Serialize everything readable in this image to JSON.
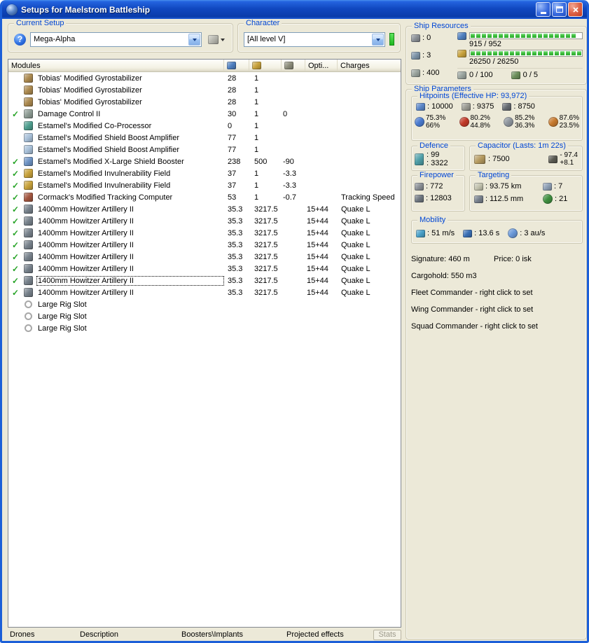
{
  "window": {
    "title": "Setups for Maelstrom Battleship"
  },
  "setup_panel": {
    "label": "Current Setup",
    "value": "Mega-Alpha"
  },
  "character_panel": {
    "label": "Character",
    "value": "[All level V]"
  },
  "modules_table": {
    "title": "Modules",
    "opti_column": "Opti...",
    "charges_column": "Charges",
    "rows": [
      {
        "active": false,
        "selected": false,
        "icon": "gyrostabilizer-icon",
        "shape": "square",
        "color": "#AC8A50",
        "name": "Tobias' Modified Gyrostabilizer",
        "cpu": "28",
        "pg": "1",
        "cap": "",
        "opti": "",
        "charges": ""
      },
      {
        "active": false,
        "selected": false,
        "icon": "gyrostabilizer-icon",
        "shape": "square",
        "color": "#AC8A50",
        "name": "Tobias' Modified Gyrostabilizer",
        "cpu": "28",
        "pg": "1",
        "cap": "",
        "opti": "",
        "charges": ""
      },
      {
        "active": false,
        "selected": false,
        "icon": "gyrostabilizer-icon",
        "shape": "square",
        "color": "#AC8A50",
        "name": "Tobias' Modified Gyrostabilizer",
        "cpu": "28",
        "pg": "1",
        "cap": "",
        "opti": "",
        "charges": ""
      },
      {
        "active": true,
        "selected": false,
        "icon": "damage-control-icon",
        "shape": "square",
        "color": "#8E9C94",
        "name": "Damage Control II",
        "cpu": "30",
        "pg": "1",
        "cap": "0",
        "opti": "",
        "charges": ""
      },
      {
        "active": false,
        "selected": false,
        "icon": "co-processor-icon",
        "shape": "square",
        "color": "#4E9E8E",
        "name": "Estamel's Modified Co-Processor",
        "cpu": "0",
        "pg": "1",
        "cap": "",
        "opti": "",
        "charges": ""
      },
      {
        "active": false,
        "selected": false,
        "icon": "shield-boost-amplifier-icon",
        "shape": "square",
        "color": "#A8C0D8",
        "name": "Estamel's Modified Shield Boost Amplifier",
        "cpu": "77",
        "pg": "1",
        "cap": "",
        "opti": "",
        "charges": ""
      },
      {
        "active": false,
        "selected": false,
        "icon": "shield-boost-amplifier-icon",
        "shape": "square",
        "color": "#A8C0D8",
        "name": "Estamel's Modified Shield Boost Amplifier",
        "cpu": "77",
        "pg": "1",
        "cap": "",
        "opti": "",
        "charges": ""
      },
      {
        "active": true,
        "selected": false,
        "icon": "shield-booster-icon",
        "shape": "square",
        "color": "#6E93C4",
        "name": "Estamel's Modified X-Large Shield Booster",
        "cpu": "238",
        "pg": "500",
        "cap": "-90",
        "opti": "",
        "charges": ""
      },
      {
        "active": true,
        "selected": false,
        "icon": "invulnerability-field-icon",
        "shape": "square",
        "color": "#C8A23C",
        "name": "Estamel's Modified Invulnerability Field",
        "cpu": "37",
        "pg": "1",
        "cap": "-3.3",
        "opti": "",
        "charges": ""
      },
      {
        "active": true,
        "selected": false,
        "icon": "invulnerability-field-icon",
        "shape": "square",
        "color": "#C8A23C",
        "name": "Estamel's Modified Invulnerability Field",
        "cpu": "37",
        "pg": "1",
        "cap": "-3.3",
        "opti": "",
        "charges": ""
      },
      {
        "active": true,
        "selected": false,
        "icon": "tracking-computer-icon",
        "shape": "square",
        "color": "#A35640",
        "name": "Cormack's Modified Tracking Computer",
        "cpu": "53",
        "pg": "1",
        "cap": "-0.7",
        "opti": "",
        "charges": "Tracking Speed"
      },
      {
        "active": true,
        "selected": false,
        "icon": "artillery-icon",
        "shape": "square",
        "color": "#78828C",
        "name": "1400mm Howitzer Artillery II",
        "cpu": "35.3",
        "pg": "3217.5",
        "cap": "",
        "opti": "15+44",
        "charges": "Quake L"
      },
      {
        "active": true,
        "selected": false,
        "icon": "artillery-icon",
        "shape": "square",
        "color": "#78828C",
        "name": "1400mm Howitzer Artillery II",
        "cpu": "35.3",
        "pg": "3217.5",
        "cap": "",
        "opti": "15+44",
        "charges": "Quake L"
      },
      {
        "active": true,
        "selected": false,
        "icon": "artillery-icon",
        "shape": "square",
        "color": "#78828C",
        "name": "1400mm Howitzer Artillery II",
        "cpu": "35.3",
        "pg": "3217.5",
        "cap": "",
        "opti": "15+44",
        "charges": "Quake L"
      },
      {
        "active": true,
        "selected": false,
        "icon": "artillery-icon",
        "shape": "square",
        "color": "#78828C",
        "name": "1400mm Howitzer Artillery II",
        "cpu": "35.3",
        "pg": "3217.5",
        "cap": "",
        "opti": "15+44",
        "charges": "Quake L"
      },
      {
        "active": true,
        "selected": false,
        "icon": "artillery-icon",
        "shape": "square",
        "color": "#78828C",
        "name": "1400mm Howitzer Artillery II",
        "cpu": "35.3",
        "pg": "3217.5",
        "cap": "",
        "opti": "15+44",
        "charges": "Quake L"
      },
      {
        "active": true,
        "selected": false,
        "icon": "artillery-icon",
        "shape": "square",
        "color": "#78828C",
        "name": "1400mm Howitzer Artillery II",
        "cpu": "35.3",
        "pg": "3217.5",
        "cap": "",
        "opti": "15+44",
        "charges": "Quake L"
      },
      {
        "active": true,
        "selected": true,
        "icon": "artillery-icon",
        "shape": "square",
        "color": "#78828C",
        "name": "1400mm Howitzer Artillery II",
        "cpu": "35.3",
        "pg": "3217.5",
        "cap": "",
        "opti": "15+44",
        "charges": "Quake L"
      },
      {
        "active": true,
        "selected": false,
        "icon": "artillery-icon",
        "shape": "square",
        "color": "#78828C",
        "name": "1400mm Howitzer Artillery II",
        "cpu": "35.3",
        "pg": "3217.5",
        "cap": "",
        "opti": "15+44",
        "charges": "Quake L"
      },
      {
        "active": false,
        "selected": false,
        "icon": "rig-slot-icon",
        "shape": "ring",
        "color": "",
        "name": "Large Rig Slot",
        "cpu": "",
        "pg": "",
        "cap": "",
        "opti": "",
        "charges": ""
      },
      {
        "active": false,
        "selected": false,
        "icon": "rig-slot-icon",
        "shape": "ring",
        "color": "",
        "name": "Large Rig Slot",
        "cpu": "",
        "pg": "",
        "cap": "",
        "opti": "",
        "charges": ""
      },
      {
        "active": false,
        "selected": false,
        "icon": "rig-slot-icon",
        "shape": "ring",
        "color": "",
        "name": "Large Rig Slot",
        "cpu": "",
        "pg": "",
        "cap": "",
        "opti": "",
        "charges": ""
      }
    ]
  },
  "tabs": [
    "Drones",
    "Description",
    "Boosters\\Implants",
    "Projected effects"
  ],
  "stats_button_label": "Stats",
  "ship_resources": {
    "label": "Ship Resources",
    "turret_hardpoints": "0",
    "launcher_hardpoints": "3",
    "calibration": "400",
    "cpu_text": "915 / 952",
    "cpu_pct": 96,
    "powergrid_text": "26250 / 26250",
    "powergrid_pct": 100,
    "calibration_usage": "0 / 100",
    "drone_usage": "0 / 5"
  },
  "ship_parameters": {
    "label": "Ship Parameters",
    "hitpoints": {
      "label": "Hitpoints (Effective HP: 93,972)",
      "shield": "10000",
      "armor": "9375",
      "structure": "8750",
      "resists": [
        {
          "name": "em",
          "shield": "75.3%",
          "armor": "66%"
        },
        {
          "name": "thermal",
          "shield": "80.2%",
          "armor": "44.8%"
        },
        {
          "name": "kinetic",
          "shield": "85.2%",
          "armor": "36.3%"
        },
        {
          "name": "explosive",
          "shield": "87.6%",
          "armor": "23.5%"
        }
      ]
    },
    "defence": {
      "label": "Defence",
      "value1": "99",
      "value2": "3322"
    },
    "capacitor": {
      "label": "Capacitor (Lasts: 1m 22s)",
      "amount": "7500",
      "drain": "- 97.4",
      "peak_recharge": "+8.1"
    },
    "firepower": {
      "label": "Firepower",
      "dps": "772",
      "volley": "12803"
    },
    "targeting": {
      "label": "Targeting",
      "range": "93.75 km",
      "max_targets": "7",
      "scan_resolution": "112.5 mm",
      "sensor_strength": "21"
    },
    "mobility": {
      "label": "Mobility",
      "max_velocity": "51 m/s",
      "align_time": "13.6 s",
      "warp_speed": "3 au/s"
    },
    "info": {
      "signature": "Signature: 460 m",
      "price": "Price: 0 isk",
      "cargohold": "Cargohold: 550 m3",
      "fleet_commander": "Fleet Commander - right click to set",
      "wing_commander": "Wing Commander - right click to set",
      "squad_commander": "Squad Commander - right click to set"
    }
  }
}
